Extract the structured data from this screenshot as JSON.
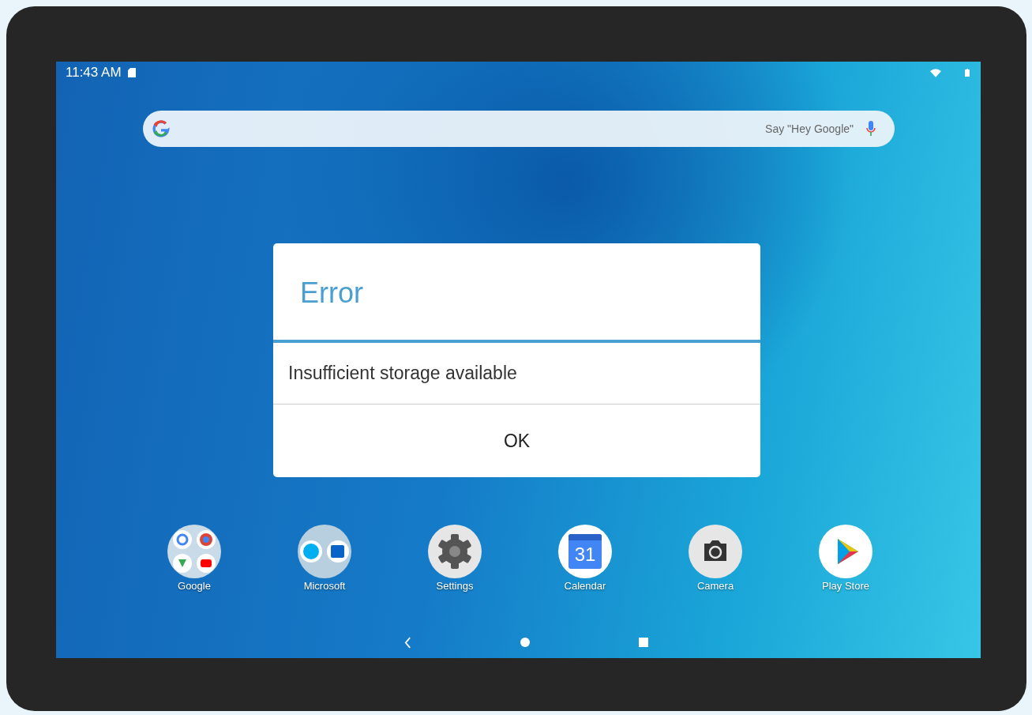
{
  "status_bar": {
    "time": "11:43 AM"
  },
  "search": {
    "placeholder": "Say \"Hey Google\""
  },
  "dialog": {
    "title": "Error",
    "message": "Insufficient storage available",
    "button": "OK"
  },
  "dock": [
    {
      "label": "Google",
      "kind": "google-folder"
    },
    {
      "label": "Microsoft",
      "kind": "microsoft-folder"
    },
    {
      "label": "Settings",
      "kind": "settings"
    },
    {
      "label": "Calendar",
      "kind": "calendar",
      "icon_text": "31"
    },
    {
      "label": "Camera",
      "kind": "camera"
    },
    {
      "label": "Play Store",
      "kind": "store"
    }
  ]
}
